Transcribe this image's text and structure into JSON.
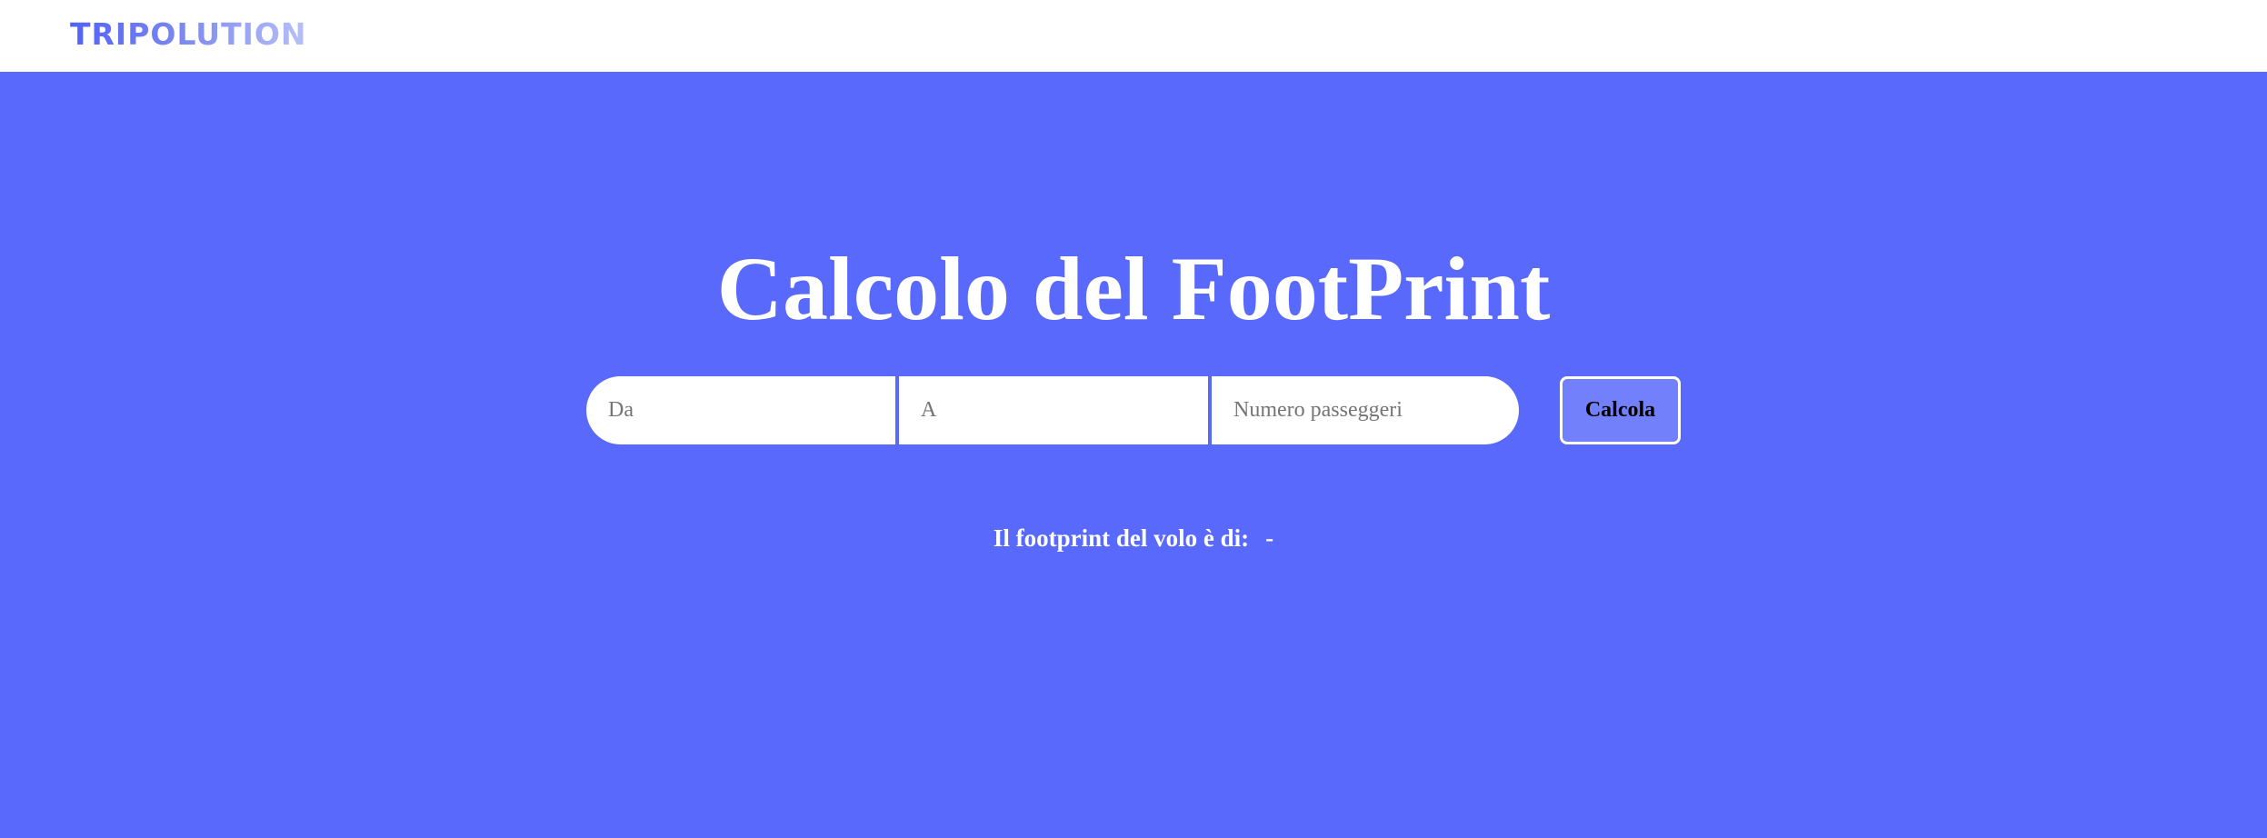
{
  "navbar": {
    "logo_text": "TRIPOLUTION"
  },
  "hero": {
    "title": "Calcolo del FootPrint",
    "inputs": {
      "from_placeholder": "Da",
      "to_placeholder": "A",
      "passengers_placeholder": "Numero passeggeri",
      "from_value": "",
      "to_value": "",
      "passengers_value": ""
    },
    "calculate_label": "Calcola",
    "result_label": "Il footprint del volo è di:",
    "result_value": "-"
  },
  "colors": {
    "background": "#5869fb",
    "navbar": "#ffffff",
    "button": "#7380fb",
    "text": "#ffffff"
  }
}
